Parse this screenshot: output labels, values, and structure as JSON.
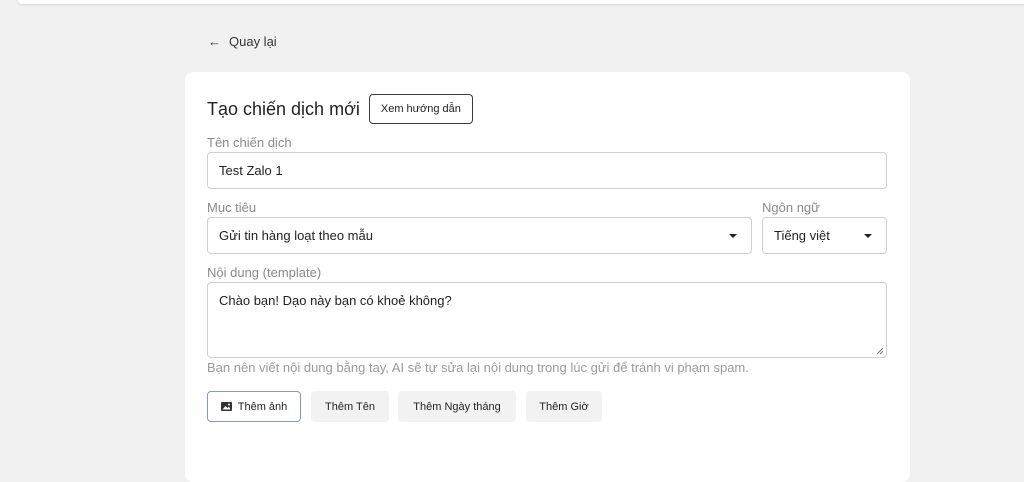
{
  "nav": {
    "back_label": "Quay lại"
  },
  "form": {
    "title": "Tạo chiến dịch mới",
    "guide_button": "Xem hướng dẫn",
    "name_label": "Tên chiến dịch",
    "name_value": "Test Zalo 1",
    "goal_label": "Mục tiêu",
    "goal_value": "Gửi tin hàng loạt theo mẫu",
    "language_label": "Ngôn ngữ",
    "language_value": "Tiếng việt",
    "content_label": "Nội dung (template)",
    "content_value": "Chào bạn! Dạo này bạn có khoẻ không?",
    "hint": "Bạn nên viết nội dung bằng tay, AI sẽ tự sửa lại nội dung trong lúc gửi để tránh vi phạm spam."
  },
  "actions": {
    "add_image": "Thêm ảnh",
    "add_name": "Thêm Tên",
    "add_date": "Thêm Ngày tháng",
    "add_time": "Thêm Giờ"
  },
  "colors": {
    "accent_border": "#8a8fe0",
    "background": "#f1f1f1",
    "card": "#ffffff"
  }
}
